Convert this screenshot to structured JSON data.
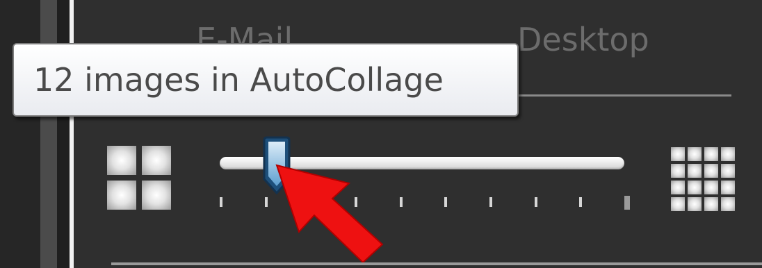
{
  "tabs": [
    {
      "label": "E-Mail"
    },
    {
      "label": "Desktop",
      "selected": true
    }
  ],
  "tooltip": {
    "text": "12 images in AutoCollage"
  },
  "slider": {
    "ticks": 10,
    "value_fraction": 0.12
  },
  "icons": {
    "fewer": "grid-2x2-icon",
    "more": "grid-4x4-icon",
    "annotation": "red-arrow-icon"
  },
  "colors": {
    "annotation": "#ee1111",
    "thumb": "#7fb6dd"
  }
}
